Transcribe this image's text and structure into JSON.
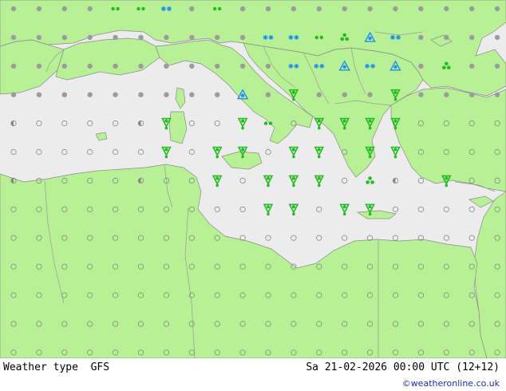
{
  "title": "Weather type",
  "model": "GFS",
  "valid_time": "Sa 21-02-2026 00:00 UTC (12+12)",
  "credit": "©weatheronline.co.uk",
  "colors": {
    "land": "#b8f195",
    "sea": "#ececec",
    "border": "#999999",
    "coast": "#8a8a8a",
    "drizzle": "#22bb22",
    "rain_shower": "#22bb22",
    "snow": "#1f8ef0",
    "cloud_dot": "#9c9c9c",
    "clear_marker": "#888888"
  },
  "legend_icons": {
    "clear": "open-circle-icon",
    "half": "half-filled-circle-icon",
    "overcast": "filled-circle-icon",
    "drizzle": "drizzle-icon",
    "rain_shower": "rain-shower-icon",
    "snow": "snowflake-icon",
    "snow_shower": "snow-shower-icon",
    "thunder": "thunder-icon",
    "hail": "cluster-icon"
  }
}
